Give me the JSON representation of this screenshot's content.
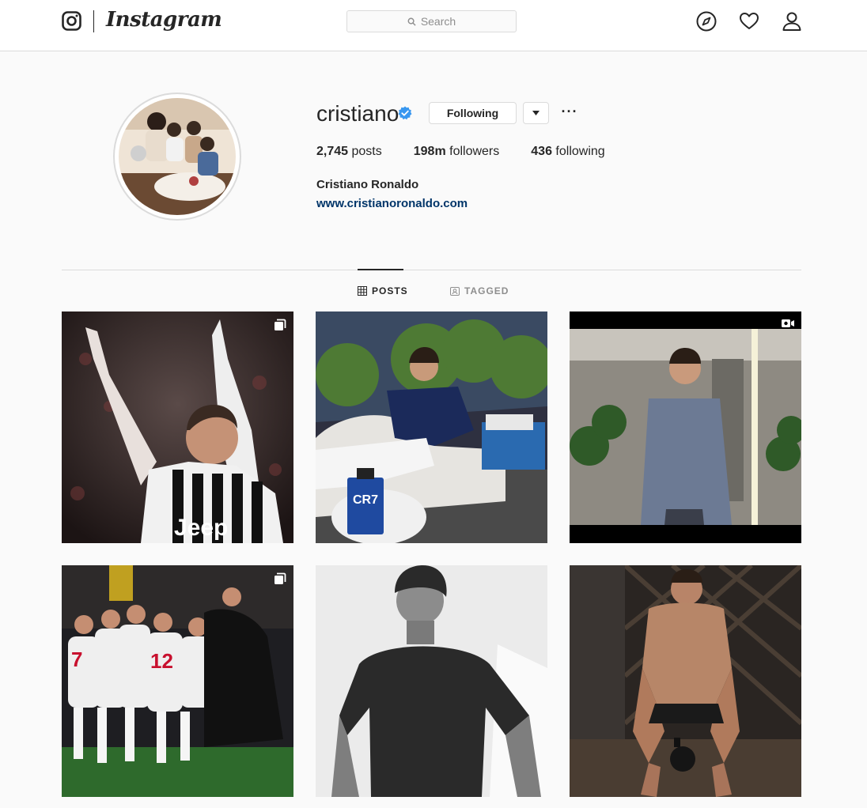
{
  "app": {
    "name": "Instagram"
  },
  "nav": {
    "search_placeholder": "Search",
    "icons": [
      "camera-logo-icon",
      "compass-icon",
      "heart-icon",
      "person-icon"
    ]
  },
  "profile": {
    "username": "cristiano",
    "verified": true,
    "follow_button_label": "Following",
    "more_label": "···",
    "stats": [
      {
        "count": "2,745",
        "label": "posts"
      },
      {
        "count": "198m",
        "label": "followers"
      },
      {
        "count": "436",
        "label": "following"
      }
    ],
    "full_name": "Cristiano Ronaldo",
    "website": "www.cristianoronaldo.com"
  },
  "tabs": [
    {
      "label": "POSTS",
      "active": true,
      "icon": "grid-icon"
    },
    {
      "label": "TAGGED",
      "active": false,
      "icon": "tag-icon"
    }
  ],
  "posts": [
    {
      "type": "carousel",
      "badge_icon": "carousel-icon"
    },
    {
      "type": "photo",
      "badge_icon": ""
    },
    {
      "type": "igtv",
      "badge_icon": "igtv-icon"
    },
    {
      "type": "carousel",
      "badge_icon": "carousel-icon"
    },
    {
      "type": "photo",
      "badge_icon": ""
    },
    {
      "type": "photo",
      "badge_icon": ""
    }
  ],
  "colors": {
    "verified_blue": "#3897f0",
    "link_blue": "#003569",
    "border": "#dbdbdb",
    "background": "#fafafa"
  }
}
